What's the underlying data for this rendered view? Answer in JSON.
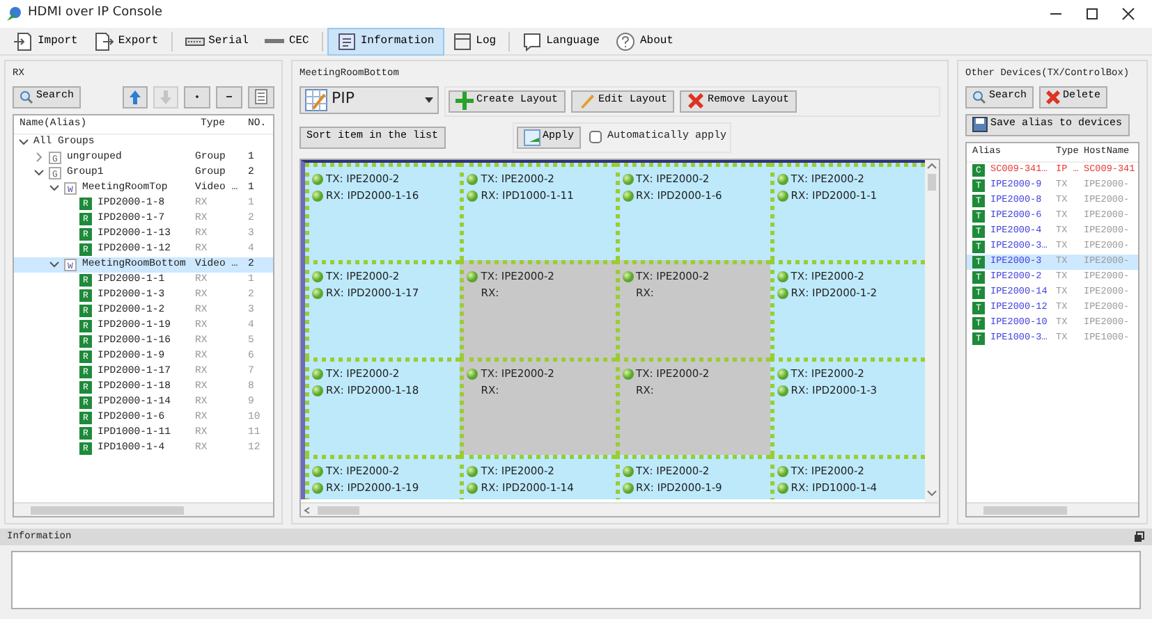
{
  "window": {
    "title": "HDMI over IP Console"
  },
  "toolbar": [
    {
      "kind": "import",
      "label": "Import",
      "selected": false
    },
    {
      "kind": "export",
      "label": "Export",
      "selected": false
    },
    {
      "kind": "serial",
      "label": "Serial",
      "selected": false
    },
    {
      "kind": "cec",
      "label": "CEC",
      "selected": false
    },
    {
      "kind": "information",
      "label": "Information",
      "selected": true
    },
    {
      "kind": "log",
      "label": "Log",
      "selected": false
    },
    {
      "kind": "language",
      "label": "Language",
      "selected": false
    },
    {
      "kind": "about",
      "label": "About",
      "selected": false
    }
  ],
  "rx_panel": {
    "title": "RX",
    "search": "Search",
    "columns": [
      "Name(Alias)",
      "Type",
      "NO."
    ],
    "tree": [
      {
        "label": "All Groups",
        "expanded": true,
        "selected": false,
        "children": [
          {
            "badge": "G",
            "kind": "group",
            "label": "ungrouped",
            "type": "Group",
            "no": "1",
            "expanded": false,
            "selected": false
          },
          {
            "badge": "G",
            "kind": "group",
            "label": "Group1",
            "type": "Group",
            "no": "2",
            "expanded": true,
            "selected": false,
            "children": [
              {
                "badge": "W",
                "kind": "wall",
                "label": "MeetingRoomTop",
                "type": "Video …",
                "no": "1",
                "expanded": true,
                "selected": false,
                "children": [
                  {
                    "badge": "R",
                    "kind": "rx",
                    "label": "IPD2000-1-8",
                    "type": "RX",
                    "no": "1",
                    "selected": false
                  },
                  {
                    "badge": "R",
                    "kind": "rx",
                    "label": "IPD2000-1-7",
                    "type": "RX",
                    "no": "2",
                    "selected": false
                  },
                  {
                    "badge": "R",
                    "kind": "rx",
                    "label": "IPD2000-1-13",
                    "type": "RX",
                    "no": "3",
                    "selected": false
                  },
                  {
                    "badge": "R",
                    "kind": "rx",
                    "label": "IPD2000-1-12",
                    "type": "RX",
                    "no": "4",
                    "selected": false
                  }
                ]
              },
              {
                "badge": "W",
                "kind": "wall",
                "label": "MeetingRoomBottom",
                "type": "Video …",
                "no": "2",
                "expanded": true,
                "selected": true,
                "children": [
                  {
                    "badge": "R",
                    "kind": "rx",
                    "label": "IPD2000-1-1",
                    "type": "RX",
                    "no": "1",
                    "selected": false
                  },
                  {
                    "badge": "R",
                    "kind": "rx",
                    "label": "IPD2000-1-3",
                    "type": "RX",
                    "no": "2",
                    "selected": false
                  },
                  {
                    "badge": "R",
                    "kind": "rx",
                    "label": "IPD2000-1-2",
                    "type": "RX",
                    "no": "3",
                    "selected": false
                  },
                  {
                    "badge": "R",
                    "kind": "rx",
                    "label": "IPD2000-1-19",
                    "type": "RX",
                    "no": "4",
                    "selected": false
                  },
                  {
                    "badge": "R",
                    "kind": "rx",
                    "label": "IPD2000-1-16",
                    "type": "RX",
                    "no": "5",
                    "selected": false
                  },
                  {
                    "badge": "R",
                    "kind": "rx",
                    "label": "IPD2000-1-9",
                    "type": "RX",
                    "no": "6",
                    "selected": false
                  },
                  {
                    "badge": "R",
                    "kind": "rx",
                    "label": "IPD2000-1-17",
                    "type": "RX",
                    "no": "7",
                    "selected": false
                  },
                  {
                    "badge": "R",
                    "kind": "rx",
                    "label": "IPD2000-1-18",
                    "type": "RX",
                    "no": "8",
                    "selected": false
                  },
                  {
                    "badge": "R",
                    "kind": "rx",
                    "label": "IPD2000-1-14",
                    "type": "RX",
                    "no": "9",
                    "selected": false
                  },
                  {
                    "badge": "R",
                    "kind": "rx",
                    "label": "IPD2000-1-6",
                    "type": "RX",
                    "no": "10",
                    "selected": false
                  },
                  {
                    "badge": "R",
                    "kind": "rx",
                    "label": "IPD1000-1-11",
                    "type": "RX",
                    "no": "11",
                    "selected": false
                  },
                  {
                    "badge": "R",
                    "kind": "rx",
                    "label": "IPD1000-1-4",
                    "type": "RX",
                    "no": "12",
                    "selected": false
                  }
                ]
              }
            ]
          }
        ]
      }
    ]
  },
  "wall_panel": {
    "title": "MeetingRoomBottom",
    "layout": "PIP",
    "buttons": [
      {
        "kind": "create",
        "label": "Create Layout"
      },
      {
        "kind": "edit",
        "label": "Edit Layout"
      },
      {
        "kind": "remove",
        "label": "Remove Layout"
      }
    ],
    "sort_button": "Sort item in the list",
    "apply_button": "Apply",
    "auto_apply": {
      "label": "Automatically apply",
      "checked": false
    },
    "cells": [
      {
        "tx": "TX: IPE2000-2",
        "rx": "RX: IPD2000-1-16",
        "assigned": true
      },
      {
        "tx": "TX: IPE2000-2",
        "rx": "RX: IPD1000-1-11",
        "assigned": true
      },
      {
        "tx": "TX: IPE2000-2",
        "rx": "RX: IPD2000-1-6",
        "assigned": true
      },
      {
        "tx": "TX: IPE2000-2",
        "rx": "RX: IPD2000-1-1",
        "assigned": true
      },
      {
        "tx": "TX: IPE2000-2",
        "rx": "RX: IPD2000-1-17",
        "assigned": true
      },
      {
        "tx": "TX: IPE2000-2",
        "rx": "RX:",
        "assigned": false
      },
      {
        "tx": "TX: IPE2000-2",
        "rx": "RX:",
        "assigned": false
      },
      {
        "tx": "TX: IPE2000-2",
        "rx": "RX: IPD2000-1-2",
        "assigned": true
      },
      {
        "tx": "TX: IPE2000-2",
        "rx": "RX: IPD2000-1-18",
        "assigned": true
      },
      {
        "tx": "TX: IPE2000-2",
        "rx": "RX:",
        "assigned": false
      },
      {
        "tx": "TX: IPE2000-2",
        "rx": "RX:",
        "assigned": false
      },
      {
        "tx": "TX: IPE2000-2",
        "rx": "RX: IPD2000-1-3",
        "assigned": true
      },
      {
        "tx": "TX: IPE2000-2",
        "rx": "RX: IPD2000-1-19",
        "assigned": true
      },
      {
        "tx": "TX: IPE2000-2",
        "rx": "RX: IPD2000-1-14",
        "assigned": true
      },
      {
        "tx": "TX: IPE2000-2",
        "rx": "RX: IPD2000-1-9",
        "assigned": true
      },
      {
        "tx": "TX: IPE2000-2",
        "rx": "RX: IPD1000-1-4",
        "assigned": true
      }
    ]
  },
  "devices_panel": {
    "title": "Other Devices(TX/ControlBox)",
    "search": "Search",
    "delete": "Delete",
    "save": "Save alias to devices",
    "columns": [
      "Alias",
      "Type",
      "HostName"
    ],
    "rows": [
      {
        "badge": "C",
        "kind": "controlbox",
        "alias": "SC009-341…",
        "type": "IP …",
        "hostname": "SC009-341",
        "selected": false
      },
      {
        "badge": "T",
        "kind": "tx",
        "alias": "IPE2000-9",
        "type": "TX",
        "hostname": "IPE2000-",
        "selected": false
      },
      {
        "badge": "T",
        "kind": "tx",
        "alias": "IPE2000-8",
        "type": "TX",
        "hostname": "IPE2000-",
        "selected": false
      },
      {
        "badge": "T",
        "kind": "tx",
        "alias": "IPE2000-6",
        "type": "TX",
        "hostname": "IPE2000-",
        "selected": false
      },
      {
        "badge": "T",
        "kind": "tx",
        "alias": "IPE2000-4",
        "type": "TX",
        "hostname": "IPE2000-",
        "selected": false
      },
      {
        "badge": "T",
        "kind": "tx",
        "alias": "IPE2000-3…",
        "type": "TX",
        "hostname": "IPE2000-",
        "selected": false
      },
      {
        "badge": "T",
        "kind": "tx",
        "alias": "IPE2000-3",
        "type": "TX",
        "hostname": "IPE2000-",
        "selected": true
      },
      {
        "badge": "T",
        "kind": "tx",
        "alias": "IPE2000-2",
        "type": "TX",
        "hostname": "IPE2000-",
        "selected": false
      },
      {
        "badge": "T",
        "kind": "tx",
        "alias": "IPE2000-14",
        "type": "TX",
        "hostname": "IPE2000-",
        "selected": false
      },
      {
        "badge": "T",
        "kind": "tx",
        "alias": "IPE2000-12",
        "type": "TX",
        "hostname": "IPE2000-",
        "selected": false
      },
      {
        "badge": "T",
        "kind": "tx",
        "alias": "IPE2000-10",
        "type": "TX",
        "hostname": "IPE2000-",
        "selected": false
      },
      {
        "badge": "T",
        "kind": "tx",
        "alias": "IPE1000-3…",
        "type": "TX",
        "hostname": "IPE1000-",
        "selected": false
      }
    ]
  },
  "info_panel": {
    "title": "Information"
  }
}
